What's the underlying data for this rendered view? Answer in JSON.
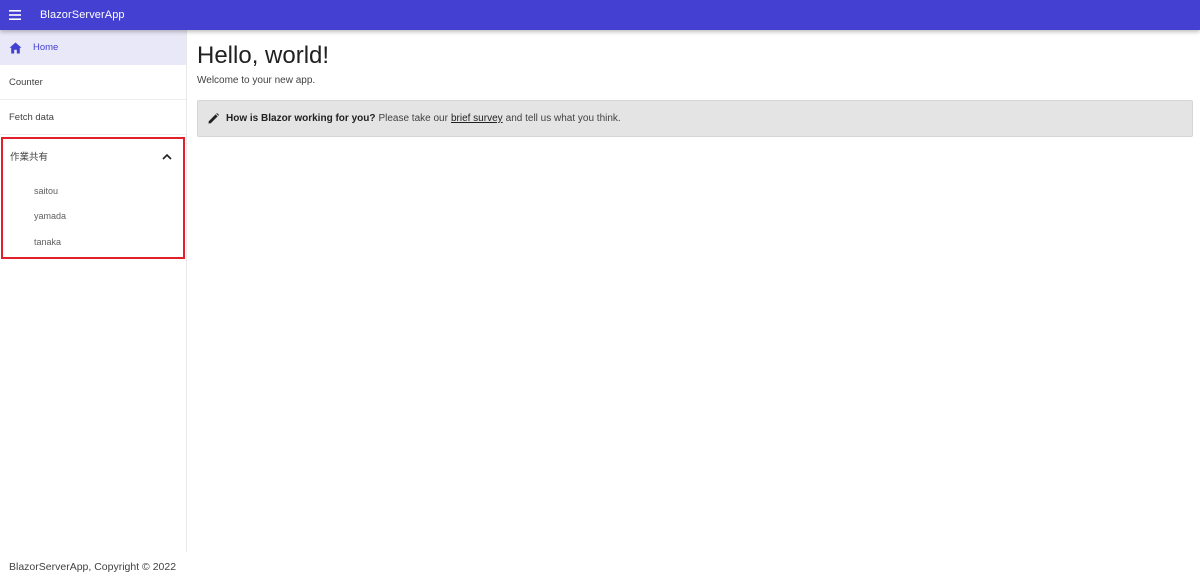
{
  "appbar": {
    "title": "BlazorServerApp",
    "menu_icon": "hamburger-menu-icon",
    "color": "#4340d2"
  },
  "nav": {
    "items": [
      {
        "label": "Home",
        "icon": "home-icon",
        "active": true
      },
      {
        "label": "Counter"
      },
      {
        "label": "Fetch data"
      }
    ],
    "group": {
      "label": "作業共有",
      "expanded": true,
      "icon": "chevron-up-icon",
      "items": [
        {
          "label": "saitou"
        },
        {
          "label": "yamada"
        },
        {
          "label": "tanaka"
        }
      ]
    }
  },
  "main": {
    "title": "Hello, world!",
    "welcome": "Welcome to your new app.",
    "survey": {
      "question": "How is Blazor working for you?",
      "text_before": "Please take our",
      "link_text": "brief survey",
      "text_after": "and tell us what you think.",
      "icon": "pencil-icon"
    }
  },
  "footer": {
    "text": "BlazorServerApp, Copyright © 2022"
  },
  "colors": {
    "accent": "#4340d2",
    "highlight_border": "#e0202a",
    "active_bg": "#e9e8f8",
    "alert_bg": "#e4e4e4"
  }
}
